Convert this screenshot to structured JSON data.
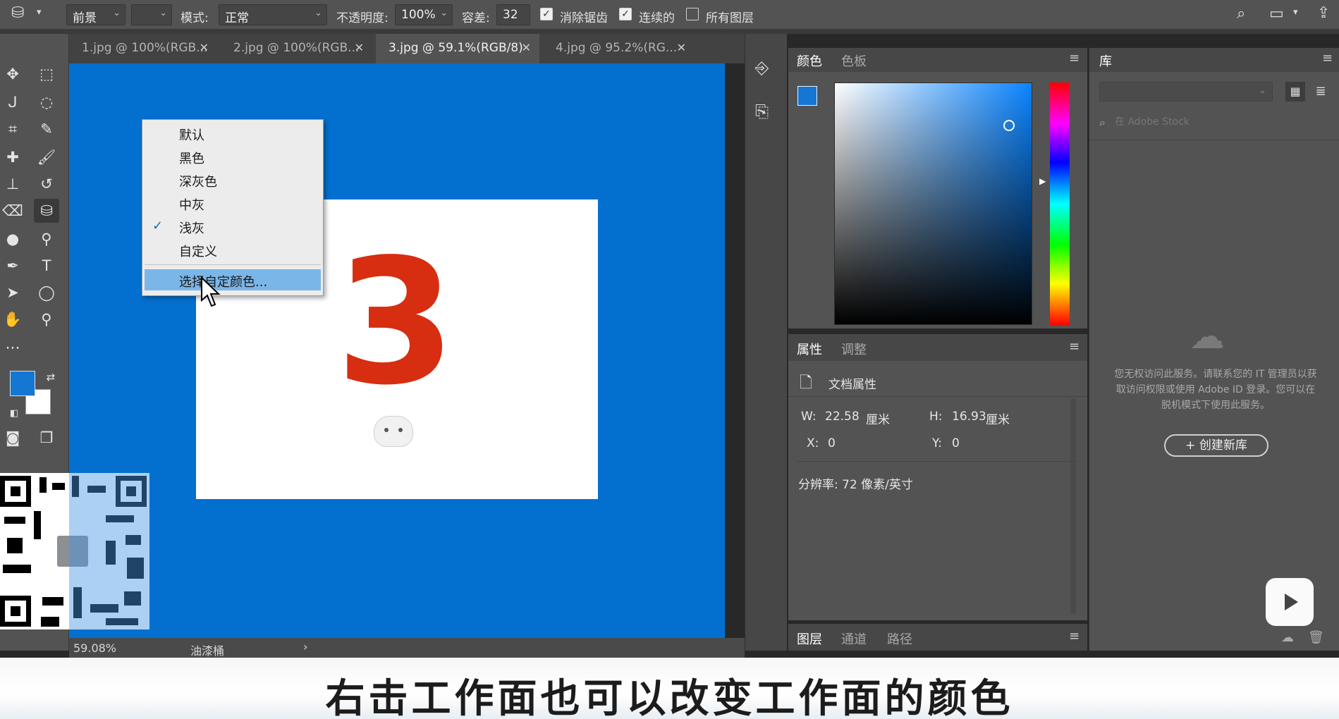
{
  "options_bar": {
    "fill_source": "前景",
    "mode_label": "模式:",
    "mode_value": "正常",
    "opacity_label": "不透明度:",
    "opacity_value": "100%",
    "tolerance_label": "容差:",
    "tolerance_value": "32",
    "antialias_label": "消除锯齿",
    "contiguous_label": "连续的",
    "all_layers_label": "所有图层"
  },
  "tabs": [
    {
      "label": "1.jpg @ 100%(RGB..."
    },
    {
      "label": "2.jpg @ 100%(RGB..."
    },
    {
      "label": "3.jpg @ 59.1%(RGB/8)"
    },
    {
      "label": "4.jpg @ 95.2%(RG..."
    }
  ],
  "canvas": {
    "number": "3",
    "colors": {
      "workspace": "#0370cf",
      "number": "#d72d10"
    }
  },
  "context_menu": {
    "items": [
      "默认",
      "黑色",
      "深灰色",
      "中灰",
      "浅灰",
      "自定义"
    ],
    "checked": "自定义",
    "action": "选择自定颜色..."
  },
  "status": {
    "zoom": "59.08%",
    "tool": "油漆桶"
  },
  "color_panel": {
    "tab_color": "颜色",
    "tab_swatches": "色板",
    "foreground": "#1477d4",
    "background": "#ffffff"
  },
  "properties": {
    "tab_props": "属性",
    "tab_adjust": "调整",
    "doc_title": "文档属性",
    "w_label": "W:",
    "w_value": "22.58",
    "w_unit": "厘米",
    "h_label": "H:",
    "h_value": "16.93",
    "h_unit": "厘米",
    "x_label": "X:",
    "x_value": "0",
    "y_label": "Y:",
    "y_value": "0",
    "resolution": "分辨率: 72 像素/英寸"
  },
  "layers_tabs": [
    "图层",
    "通道",
    "路径"
  ],
  "library": {
    "tab": "库",
    "search_placeholder": "在 Adobe Stock",
    "message": "您无权访问此服务。请联系您的 IT 管理员以获取访问权限或使用 Adobe ID 登录。您可以在脱机模式下使用此服务。",
    "create_button": "+ 创建新库"
  },
  "subtitle": "右击工作面也可以改变工作面的颜色"
}
